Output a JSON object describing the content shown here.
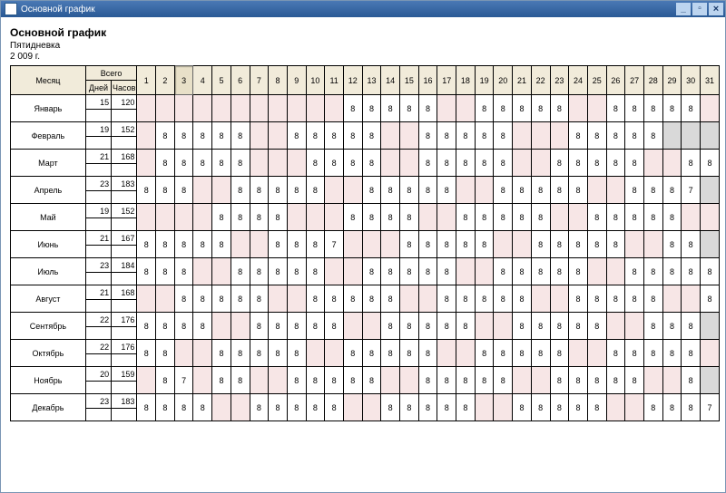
{
  "window": {
    "title": "Основной график"
  },
  "header": {
    "title": "Основной график",
    "schedule": "Пятидневка",
    "year": "2 009 г."
  },
  "columns": {
    "month": "Месяц",
    "total": "Всего",
    "days_sub": "Дней",
    "hours_sub": "Часов"
  },
  "days": 31,
  "selected_day": 3,
  "months": [
    {
      "name": "Январь",
      "days": 15,
      "hours": 120,
      "cells": [
        null,
        null,
        null,
        null,
        null,
        null,
        null,
        null,
        null,
        null,
        null,
        "8",
        "8",
        "8",
        "8",
        "8",
        null,
        null,
        "8",
        "8",
        "8",
        "8",
        "8",
        null,
        null,
        "8",
        "8",
        "8",
        "8",
        "8",
        null
      ]
    },
    {
      "name": "Февраль",
      "days": 19,
      "hours": 152,
      "cells": [
        null,
        "8",
        "8",
        "8",
        "8",
        "8",
        null,
        null,
        "8",
        "8",
        "8",
        "8",
        "8",
        null,
        null,
        "8",
        "8",
        "8",
        "8",
        "8",
        null,
        null,
        null,
        "8",
        "8",
        "8",
        "8",
        "8",
        "",
        "",
        ""
      ]
    },
    {
      "name": "Март",
      "days": 21,
      "hours": 168,
      "cells": [
        null,
        "8",
        "8",
        "8",
        "8",
        "8",
        null,
        null,
        null,
        "8",
        "8",
        "8",
        "8",
        null,
        null,
        "8",
        "8",
        "8",
        "8",
        "8",
        null,
        null,
        "8",
        "8",
        "8",
        "8",
        "8",
        null,
        null,
        "8",
        "8"
      ]
    },
    {
      "name": "Апрель",
      "days": 23,
      "hours": 183,
      "cells": [
        "8",
        "8",
        "8",
        null,
        null,
        "8",
        "8",
        "8",
        "8",
        "8",
        null,
        null,
        "8",
        "8",
        "8",
        "8",
        "8",
        null,
        null,
        "8",
        "8",
        "8",
        "8",
        "8",
        null,
        null,
        "8",
        "8",
        "8",
        "7",
        ""
      ]
    },
    {
      "name": "Май",
      "days": 19,
      "hours": 152,
      "cells": [
        null,
        null,
        null,
        null,
        "8",
        "8",
        "8",
        "8",
        null,
        null,
        null,
        "8",
        "8",
        "8",
        "8",
        null,
        null,
        "8",
        "8",
        "8",
        "8",
        "8",
        null,
        null,
        "8",
        "8",
        "8",
        "8",
        "8",
        null,
        null
      ]
    },
    {
      "name": "Июнь",
      "days": 21,
      "hours": 167,
      "cells": [
        "8",
        "8",
        "8",
        "8",
        "8",
        null,
        null,
        "8",
        "8",
        "8",
        "7",
        null,
        null,
        null,
        "8",
        "8",
        "8",
        "8",
        "8",
        null,
        null,
        "8",
        "8",
        "8",
        "8",
        "8",
        null,
        null,
        "8",
        "8",
        ""
      ]
    },
    {
      "name": "Июль",
      "days": 23,
      "hours": 184,
      "cells": [
        "8",
        "8",
        "8",
        null,
        null,
        "8",
        "8",
        "8",
        "8",
        "8",
        null,
        null,
        "8",
        "8",
        "8",
        "8",
        "8",
        null,
        null,
        "8",
        "8",
        "8",
        "8",
        "8",
        null,
        null,
        "8",
        "8",
        "8",
        "8",
        "8"
      ]
    },
    {
      "name": "Август",
      "days": 21,
      "hours": 168,
      "cells": [
        null,
        null,
        "8",
        "8",
        "8",
        "8",
        "8",
        null,
        null,
        "8",
        "8",
        "8",
        "8",
        "8",
        null,
        null,
        "8",
        "8",
        "8",
        "8",
        "8",
        null,
        null,
        "8",
        "8",
        "8",
        "8",
        "8",
        null,
        null,
        "8"
      ]
    },
    {
      "name": "Сентябрь",
      "days": 22,
      "hours": 176,
      "cells": [
        "8",
        "8",
        "8",
        "8",
        null,
        null,
        "8",
        "8",
        "8",
        "8",
        "8",
        null,
        null,
        "8",
        "8",
        "8",
        "8",
        "8",
        null,
        null,
        "8",
        "8",
        "8",
        "8",
        "8",
        null,
        null,
        "8",
        "8",
        "8",
        ""
      ]
    },
    {
      "name": "Октябрь",
      "days": 22,
      "hours": 176,
      "cells": [
        "8",
        "8",
        null,
        null,
        "8",
        "8",
        "8",
        "8",
        "8",
        null,
        null,
        "8",
        "8",
        "8",
        "8",
        "8",
        null,
        null,
        "8",
        "8",
        "8",
        "8",
        "8",
        null,
        null,
        "8",
        "8",
        "8",
        "8",
        "8",
        null
      ]
    },
    {
      "name": "Ноябрь",
      "days": 20,
      "hours": 159,
      "cells": [
        null,
        "8",
        "7",
        null,
        "8",
        "8",
        null,
        null,
        "8",
        "8",
        "8",
        "8",
        "8",
        null,
        null,
        "8",
        "8",
        "8",
        "8",
        "8",
        null,
        null,
        "8",
        "8",
        "8",
        "8",
        "8",
        null,
        null,
        "8",
        ""
      ]
    },
    {
      "name": "Декабрь",
      "days": 23,
      "hours": 183,
      "cells": [
        "8",
        "8",
        "8",
        "8",
        null,
        null,
        "8",
        "8",
        "8",
        "8",
        "8",
        null,
        null,
        "8",
        "8",
        "8",
        "8",
        "8",
        null,
        null,
        "8",
        "8",
        "8",
        "8",
        "8",
        null,
        null,
        "8",
        "8",
        "8",
        "7"
      ]
    }
  ]
}
